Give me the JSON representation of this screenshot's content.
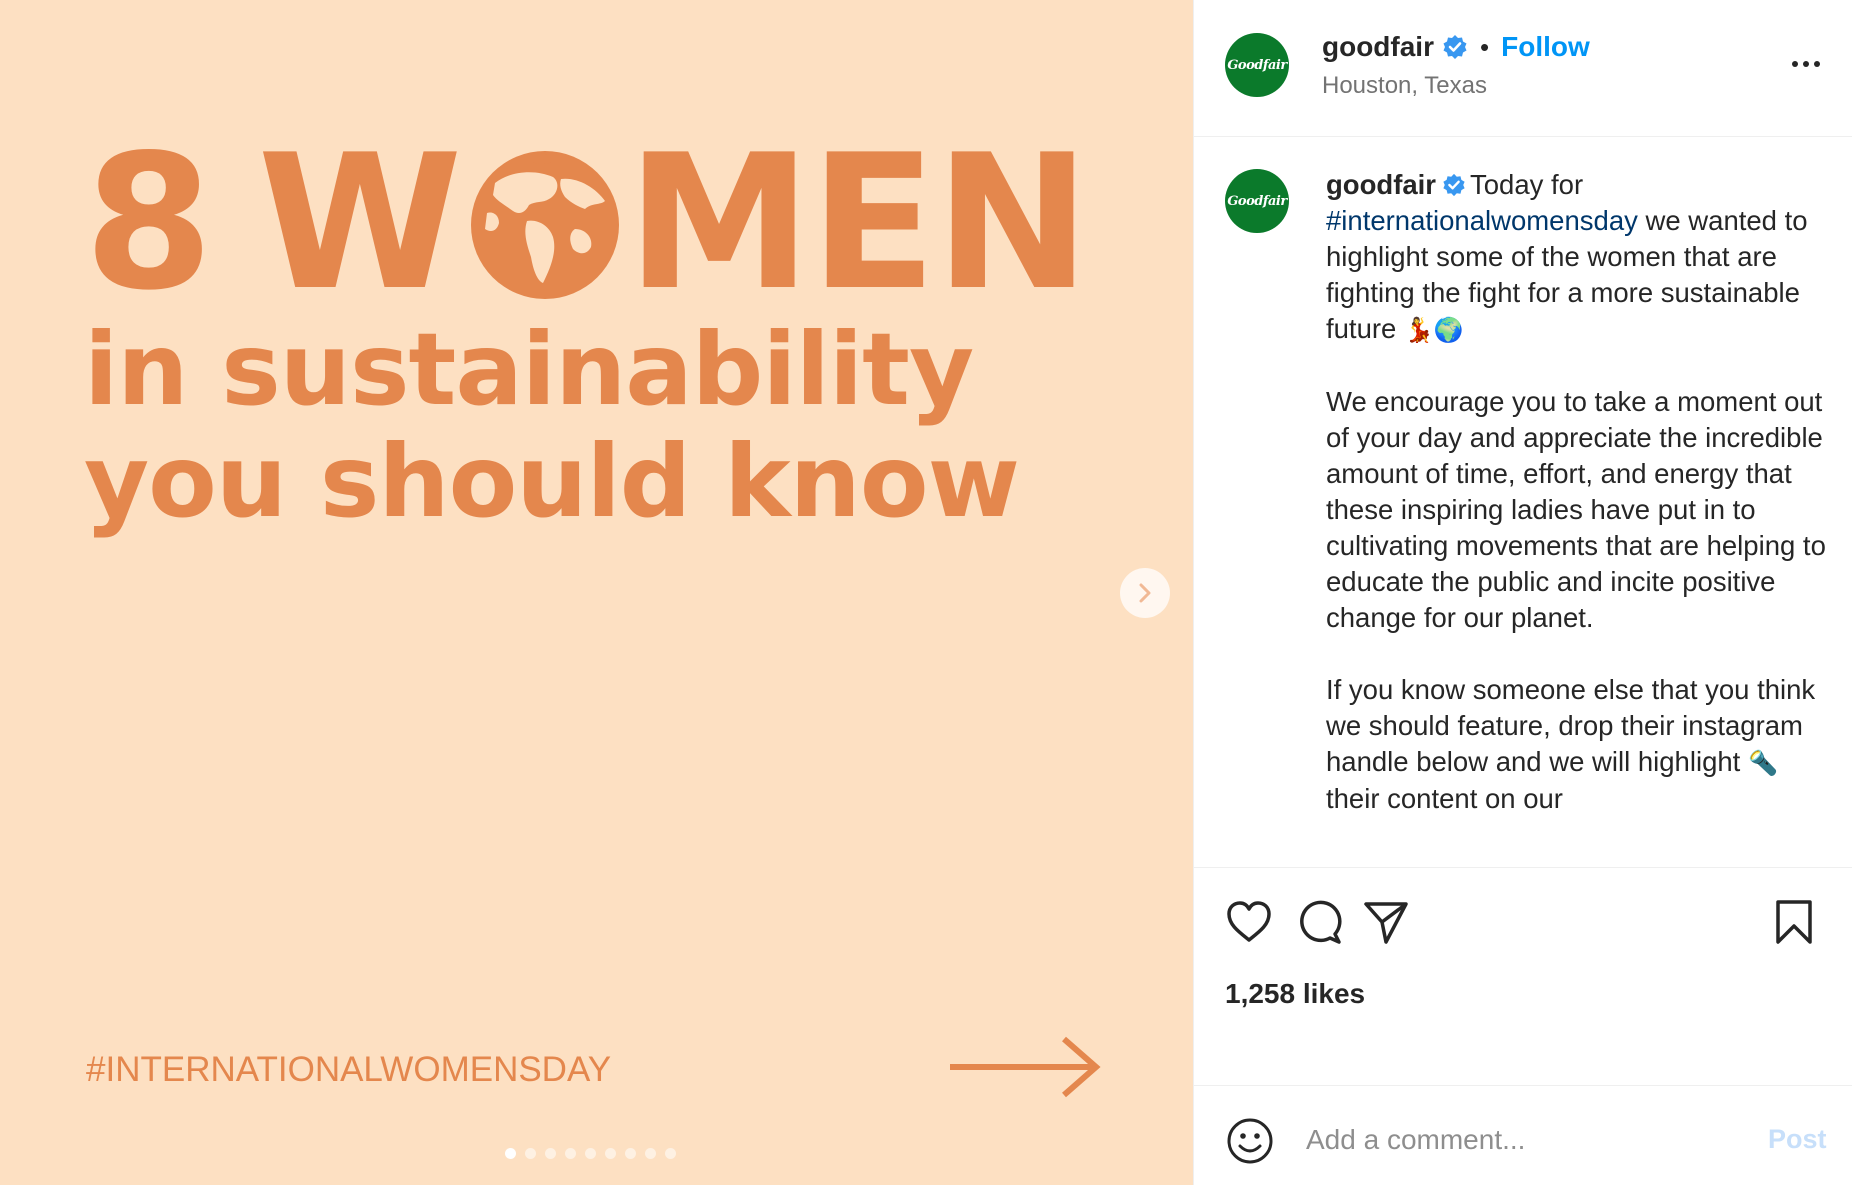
{
  "post_image": {
    "headline_number": "8",
    "headline_word_start": "W",
    "headline_word_end": "MEN",
    "headline_line2": "in sustainability",
    "headline_line3": "you should know",
    "hashtag_text": "#INTERNATIONALWOMENSDAY",
    "slide_count": 9,
    "active_slide": 1,
    "colors": {
      "background": "#fde0c2",
      "accent": "#e4874d"
    }
  },
  "header": {
    "username": "goodfair",
    "avatar_text": "Goodfair",
    "separator": "•",
    "follow_label": "Follow",
    "location": "Houston, Texas"
  },
  "caption": {
    "username": "goodfair",
    "intro": "Today for",
    "hashtag": "#internationalwomensday",
    "line1_rest": " we wanted to highlight some of the women that are fighting the fight for a more sustainable future ",
    "line1_emoji": "💃🌍",
    "paragraph2": "We encourage you to take a moment out of your day and appreciate the incredible amount of time, effort, and energy that these inspiring ladies have put in to cultivating movements that are helping to educate the public and incite positive change for our planet.",
    "paragraph3_start": "If you know someone else that you think we should feature, drop their instagram handle below and we will highlight ",
    "paragraph3_emoji": "🔦",
    "paragraph3_end": " their content on our"
  },
  "actions": {
    "icons": [
      "heart-icon",
      "comment-icon",
      "share-icon",
      "bookmark-icon"
    ]
  },
  "likes": "1,258 likes",
  "comment": {
    "placeholder": "Add a comment...",
    "post_label": "Post"
  },
  "colors": {
    "link_blue": "#0095f6",
    "hashtag_blue": "#00376b",
    "text_primary": "#262626",
    "text_secondary": "#737373",
    "avatar_green": "#0b7a2b",
    "verified_blue": "#3897f0"
  }
}
